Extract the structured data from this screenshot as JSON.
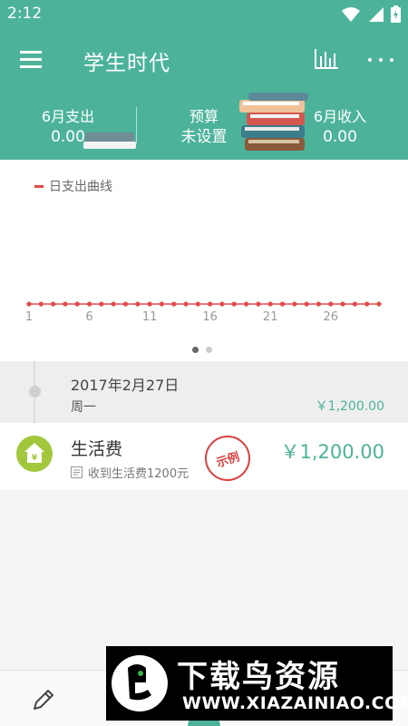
{
  "status_bar": {
    "time": "2:12"
  },
  "app_bar": {
    "title": "学生时代"
  },
  "summary": {
    "expense_label": "6月支出",
    "expense_value": "0.00",
    "budget_label": "预算",
    "budget_value": "未设置",
    "income_label": "6月收入",
    "income_value": "0.00"
  },
  "chart_data": {
    "type": "line",
    "legend": [
      "日支出曲线"
    ],
    "x_ticks": [
      "1",
      "6",
      "11",
      "16",
      "21",
      "26"
    ],
    "x": [
      1,
      2,
      3,
      4,
      5,
      6,
      7,
      8,
      9,
      10,
      11,
      12,
      13,
      14,
      15,
      16,
      17,
      18,
      19,
      20,
      21,
      22,
      23,
      24,
      25,
      26,
      27,
      28,
      29,
      30
    ],
    "series": [
      {
        "name": "日支出曲线",
        "values": [
          0,
          0,
          0,
          0,
          0,
          0,
          0,
          0,
          0,
          0,
          0,
          0,
          0,
          0,
          0,
          0,
          0,
          0,
          0,
          0,
          0,
          0,
          0,
          0,
          0,
          0,
          0,
          0,
          0,
          0
        ]
      }
    ],
    "grid": false,
    "color": "#e24c4c"
  },
  "pager": {
    "count": 2,
    "active": 0
  },
  "record_group": {
    "date": "2017年2月27日",
    "weekday": "周一",
    "total": "￥1,200.00"
  },
  "entry": {
    "title": "生活费",
    "note": "收到生活费1200元",
    "amount": "￥1,200.00",
    "stamp": "示例",
    "icon": "home-yuan-icon"
  },
  "watermark": {
    "title": "下载鸟资源",
    "url": "WWW.XIAZAINIAO.COM"
  },
  "colors": {
    "primary": "#4cb39a",
    "accent_red": "#e24c4c",
    "entry_icon": "#a2c73c"
  }
}
